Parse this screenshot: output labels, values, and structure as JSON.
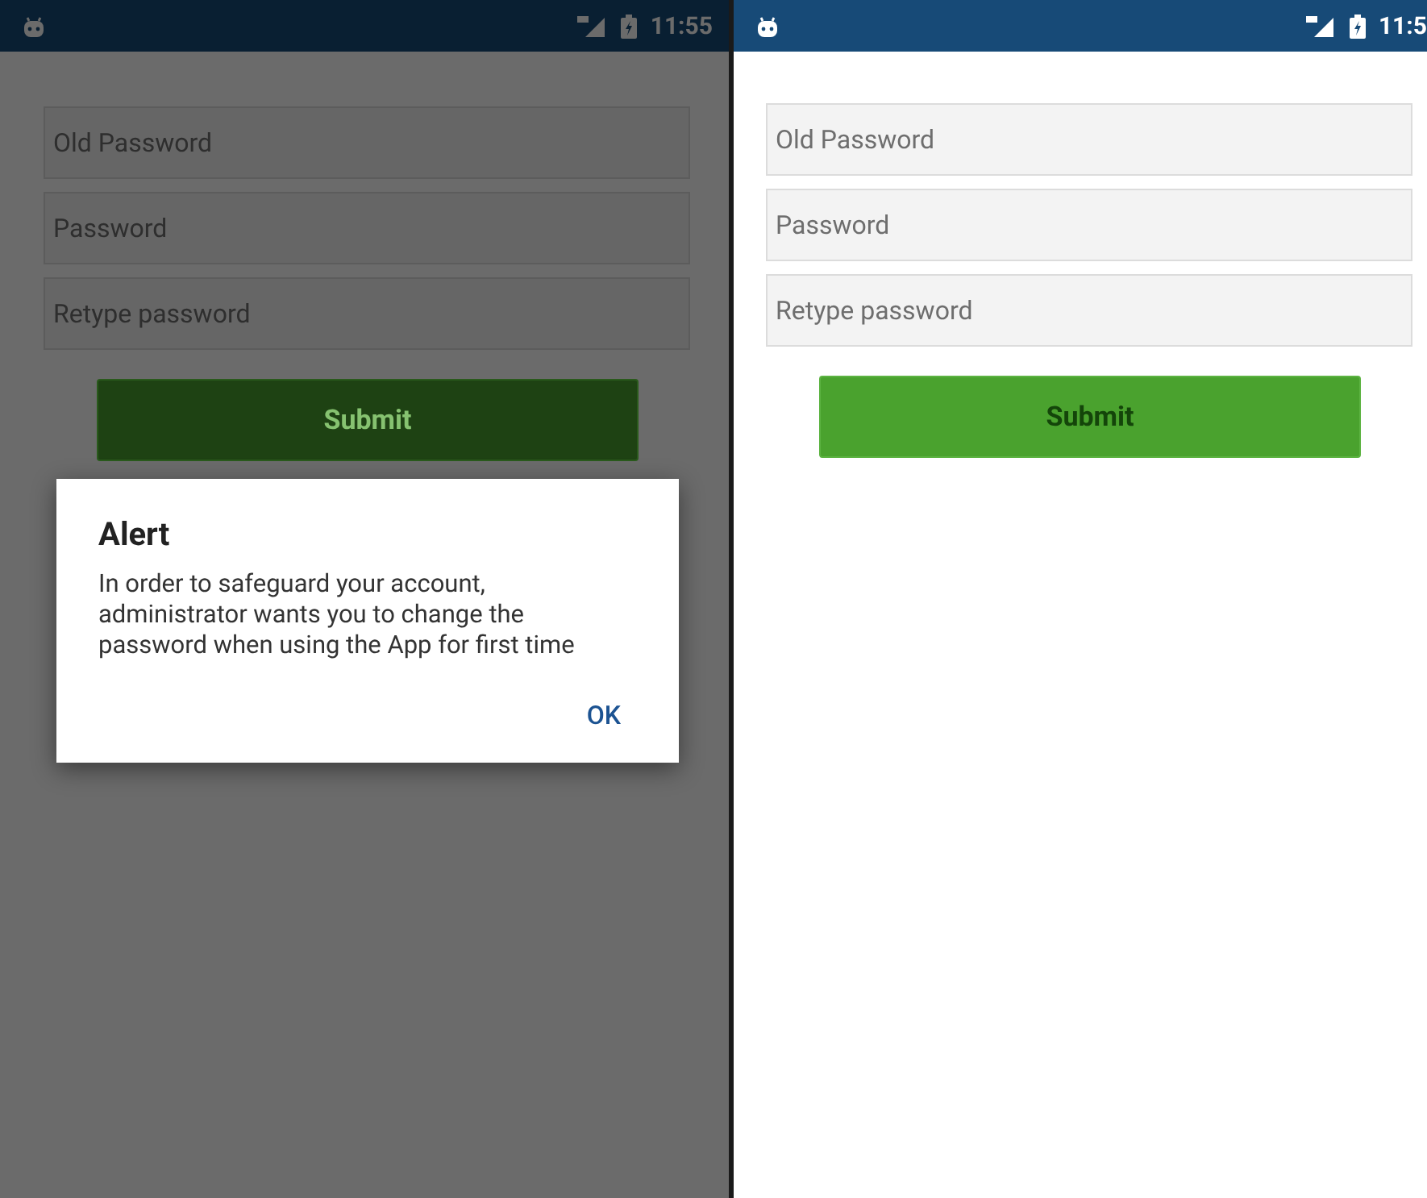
{
  "screens": [
    {
      "status_bar": {
        "time": "11:55"
      },
      "dimmed": true,
      "fields": [
        {
          "placeholder": "Old Password"
        },
        {
          "placeholder": "Password"
        },
        {
          "placeholder": "Retype password"
        }
      ],
      "submit": "Submit",
      "dialog": {
        "title": "Alert",
        "message": "In order to safeguard your account, administrator wants you to change the password when using the App for first time",
        "buttons": [
          "OK"
        ]
      }
    },
    {
      "status_bar": {
        "time": "11:5"
      },
      "dimmed": false,
      "fields": [
        {
          "placeholder": "Old Password"
        },
        {
          "placeholder": "Password"
        },
        {
          "placeholder": "Retype password"
        }
      ],
      "submit": "Submit"
    }
  ]
}
